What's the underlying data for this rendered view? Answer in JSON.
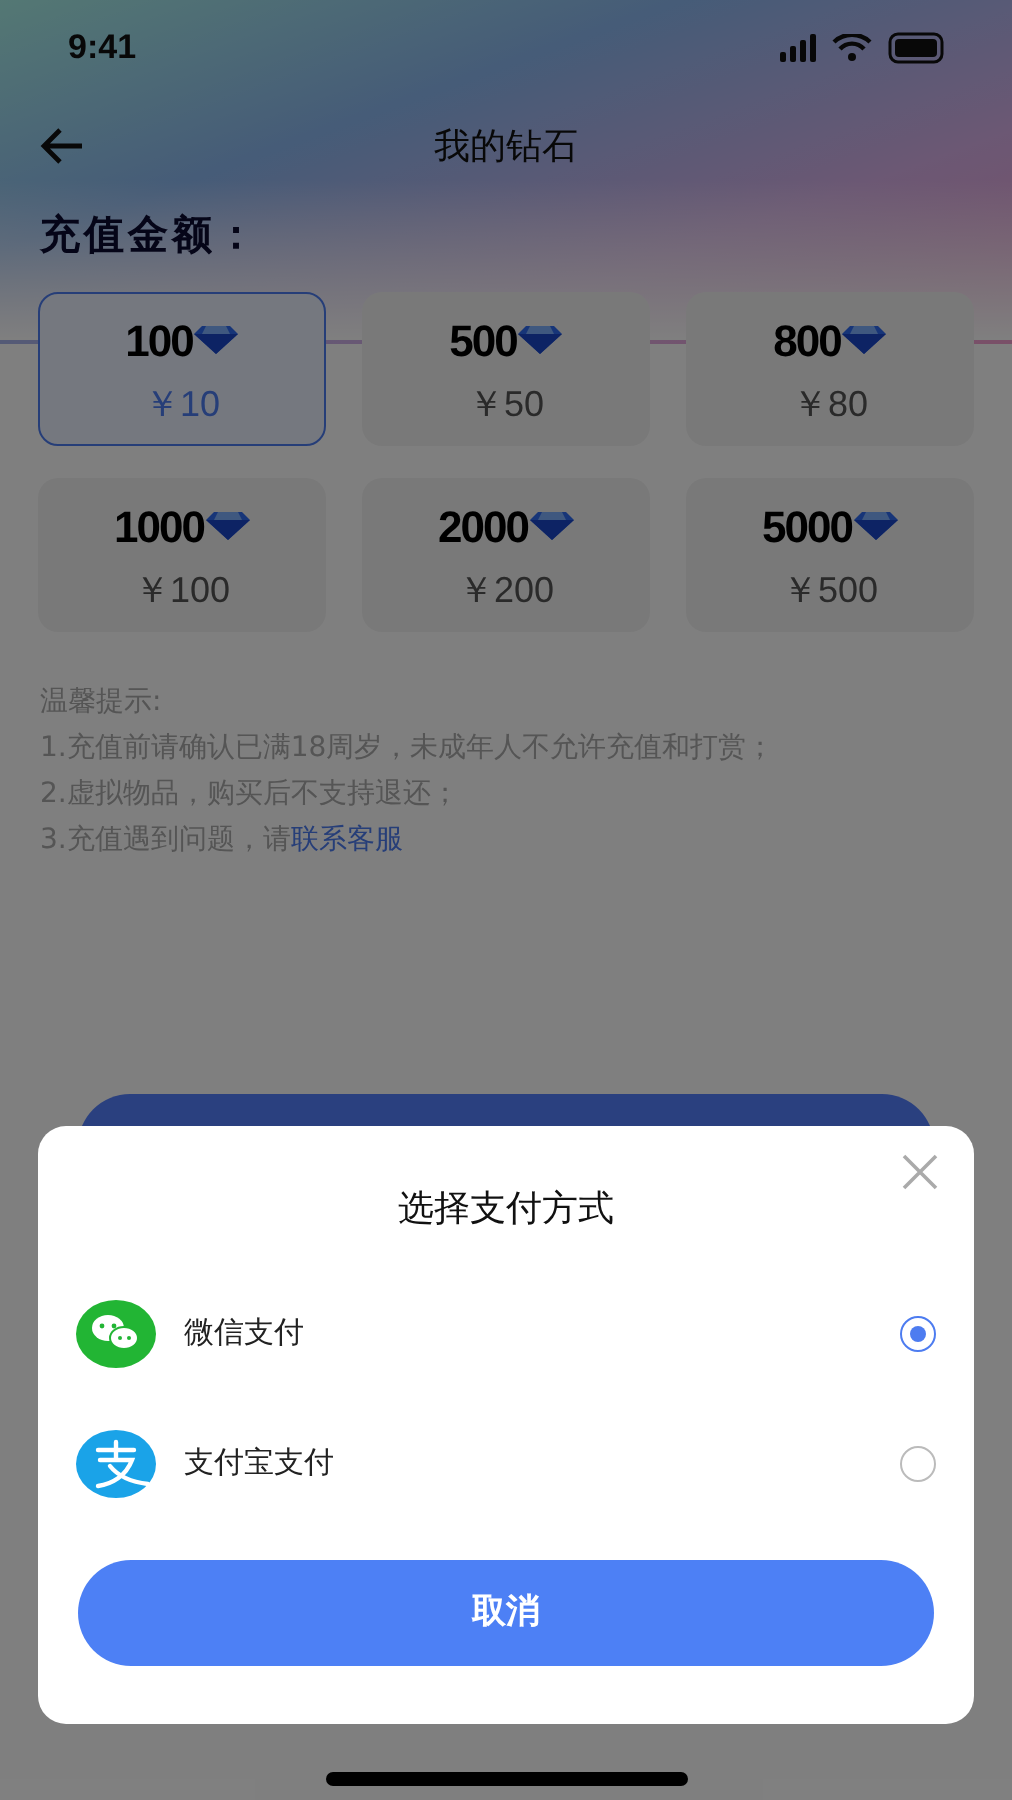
{
  "status_bar": {
    "time": "9:41"
  },
  "nav": {
    "title": "我的钻石"
  },
  "section_title": "充值金额：",
  "packages": [
    {
      "amount": "100",
      "price": "￥10",
      "selected": true
    },
    {
      "amount": "500",
      "price": "￥50",
      "selected": false
    },
    {
      "amount": "800",
      "price": "￥80",
      "selected": false
    },
    {
      "amount": "1000",
      "price": "￥100",
      "selected": false
    },
    {
      "amount": "2000",
      "price": "￥200",
      "selected": false
    },
    {
      "amount": "5000",
      "price": "￥500",
      "selected": false
    }
  ],
  "notes": {
    "title": "温馨提示:",
    "lines": [
      "1.充值前请确认已满18周岁，未成年人不允许充值和打赏；",
      "2.虚拟物品，购买后不支持退还；"
    ],
    "last_line": "3.充值遇到问题，请",
    "link": "联系客服"
  },
  "payment_sheet": {
    "title": "选择支付方式",
    "methods": [
      {
        "label": "微信支付",
        "kind": "wechat",
        "selected": true
      },
      {
        "label": "支付宝支付",
        "kind": "alipay",
        "selected": false
      }
    ],
    "cancel_button": "取消"
  }
}
